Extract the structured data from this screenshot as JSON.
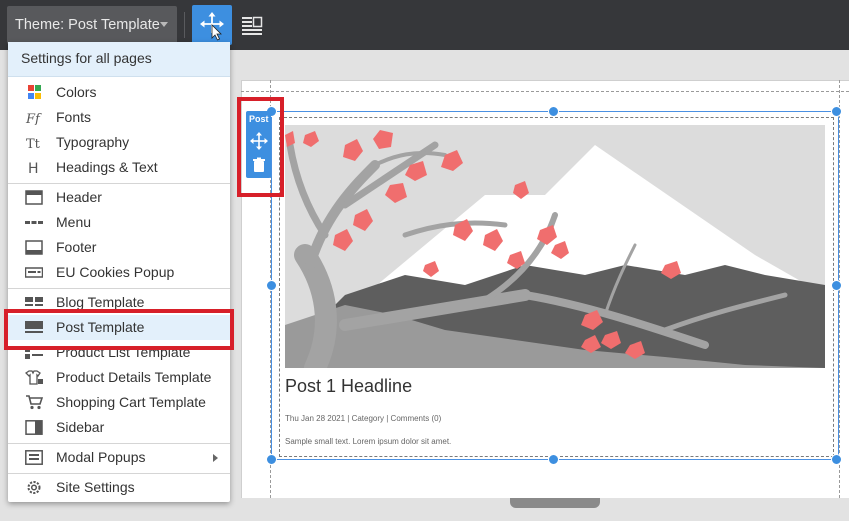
{
  "toolbar": {
    "theme_label": "Theme: Post Template"
  },
  "menu": {
    "header": "Settings for all pages",
    "items": [
      {
        "label": "Colors",
        "icon": "colors-icon"
      },
      {
        "label": "Fonts",
        "icon": "fonts-icon"
      },
      {
        "label": "Typography",
        "icon": "typography-icon"
      },
      {
        "label": "Headings & Text",
        "icon": "headings-icon"
      },
      {
        "label": "Header",
        "icon": "header-icon"
      },
      {
        "label": "Menu",
        "icon": "menu-icon"
      },
      {
        "label": "Footer",
        "icon": "footer-icon"
      },
      {
        "label": "EU Cookies Popup",
        "icon": "cookies-popup-icon"
      },
      {
        "label": "Blog Template",
        "icon": "blog-template-icon"
      },
      {
        "label": "Post Template",
        "icon": "post-template-icon",
        "selected": true
      },
      {
        "label": "Product List Template",
        "icon": "product-list-icon"
      },
      {
        "label": "Product Details Template",
        "icon": "product-details-icon"
      },
      {
        "label": "Shopping Cart Template",
        "icon": "shopping-cart-icon"
      },
      {
        "label": "Sidebar",
        "icon": "sidebar-icon"
      },
      {
        "label": "Modal Popups",
        "icon": "modal-popups-icon",
        "has_submenu": true
      },
      {
        "label": "Site Settings",
        "icon": "settings-gear-icon"
      }
    ]
  },
  "block": {
    "tool_label": "Post"
  },
  "post": {
    "headline": "Post 1 Headline",
    "meta": "Thu Jan 28 2021  |  Category  |  Comments (0)",
    "text": "Sample small text. Lorem ipsum dolor sit amet."
  },
  "colors": {
    "accent": "#3d8fe0",
    "highlight": "#d71f29",
    "selected_bg": "#e3f0fb",
    "blossom": "#f06e6e"
  }
}
